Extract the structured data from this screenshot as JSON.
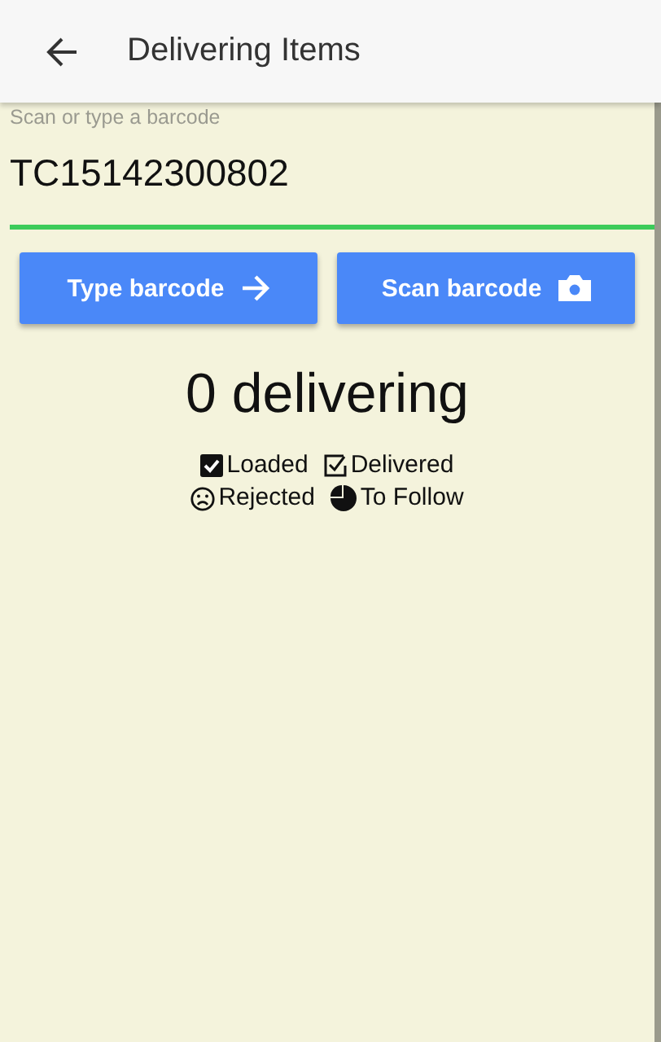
{
  "app_bar": {
    "title": "Delivering Items"
  },
  "barcode_field": {
    "label": "Scan or type a barcode",
    "value": "TC15142300802"
  },
  "buttons": [
    {
      "label": "Type barcode",
      "kind": "arrow"
    },
    {
      "label": "Scan barcode",
      "kind": "camera"
    }
  ],
  "count": "0 delivering",
  "legend": [
    [
      {
        "label": "Loaded",
        "kind": "checked"
      },
      {
        "label": "Delivered",
        "kind": "check-outline"
      }
    ],
    [
      {
        "label": "Rejected",
        "kind": "sad"
      },
      {
        "label": "To Follow",
        "kind": "pie"
      }
    ]
  ]
}
